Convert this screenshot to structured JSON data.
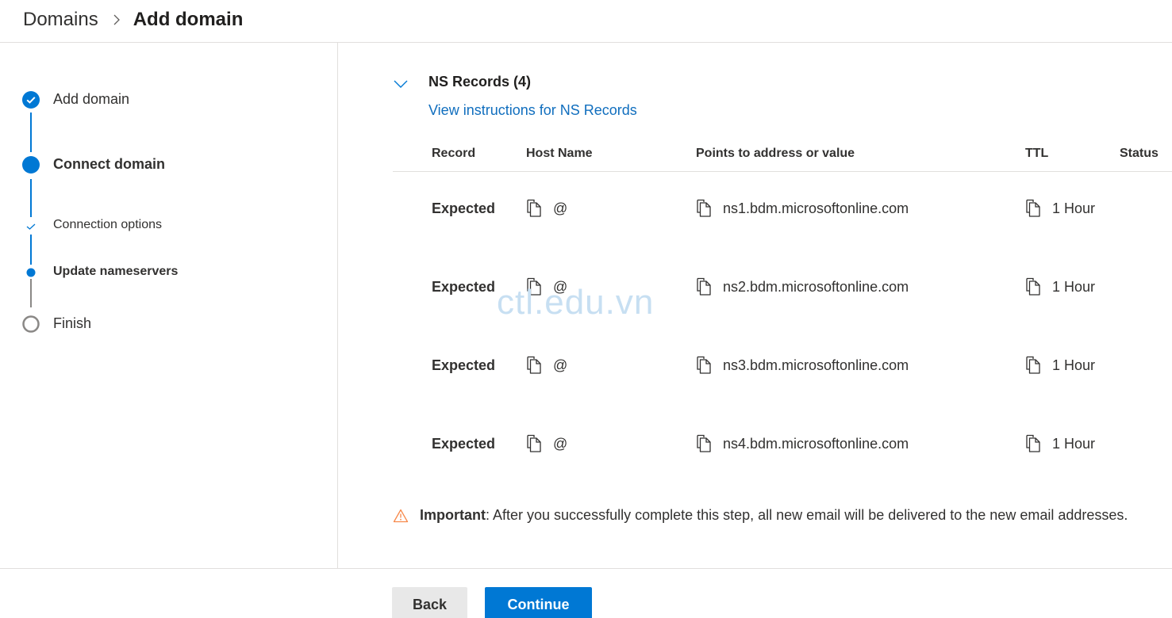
{
  "breadcrumb": {
    "root": "Domains",
    "separator_icon": "chevron-right-icon",
    "current": "Add domain"
  },
  "stepper": {
    "steps": [
      {
        "label": "Add domain",
        "state": "completed",
        "level": "major",
        "icon": "check-circle-icon"
      },
      {
        "label": "Connect domain",
        "state": "current",
        "level": "major",
        "icon": "filled-circle-icon"
      },
      {
        "label": "Connection options",
        "state": "completed",
        "level": "minor",
        "icon": "check-icon"
      },
      {
        "label": "Update nameservers",
        "state": "current",
        "level": "minor",
        "icon": "dot-icon"
      },
      {
        "label": "Finish",
        "state": "pending",
        "level": "major",
        "icon": "empty-circle-icon"
      }
    ]
  },
  "section": {
    "title": "NS Records (4)",
    "expanded": true,
    "instructions_link": "View instructions for NS Records"
  },
  "table": {
    "columns": [
      "Record",
      "Host Name",
      "Points to address or value",
      "TTL",
      "Status"
    ],
    "rows": [
      {
        "record": "Expected",
        "host": "@",
        "value": "ns1.bdm.microsoftonline.com",
        "ttl": "1 Hour",
        "status": ""
      },
      {
        "record": "Expected",
        "host": "@",
        "value": "ns2.bdm.microsoftonline.com",
        "ttl": "1 Hour",
        "status": ""
      },
      {
        "record": "Expected",
        "host": "@",
        "value": "ns3.bdm.microsoftonline.com",
        "ttl": "1 Hour",
        "status": ""
      },
      {
        "record": "Expected",
        "host": "@",
        "value": "ns4.bdm.microsoftonline.com",
        "ttl": "1 Hour",
        "status": ""
      }
    ]
  },
  "notice": {
    "icon": "warning-icon",
    "label": "Important",
    "text": ": After you successfully complete this step, all new email will be delivered to the new email addresses."
  },
  "watermark": "ctl.edu.vn",
  "buttons": {
    "back": "Back",
    "continue": "Continue"
  },
  "colors": {
    "accent": "#0078d4",
    "link": "#106ebe",
    "warning": "#f7894a",
    "pending": "#8a8886"
  }
}
